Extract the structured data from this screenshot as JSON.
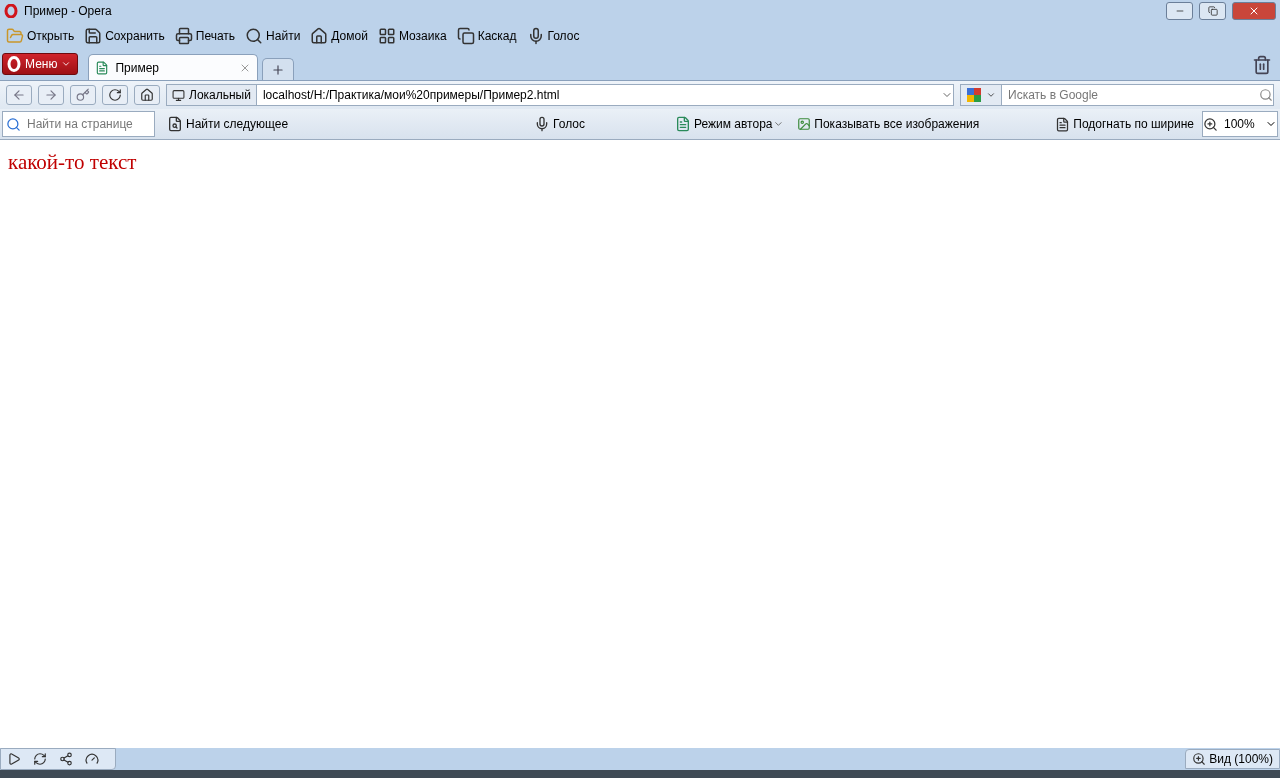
{
  "window": {
    "title": "Пример - Opera"
  },
  "toolbar": {
    "buttons": [
      "Открыть",
      "Сохранить",
      "Печать",
      "Найти",
      "Домой",
      "Мозаика",
      "Каскад",
      "Голос"
    ]
  },
  "menu_button": {
    "label": "Меню"
  },
  "tabs": [
    {
      "label": "Пример",
      "selected": true
    }
  ],
  "address_bar": {
    "badge": "Локальный",
    "url": "localhost/H:/Практика/мои%20примеры/Пример2.html"
  },
  "search": {
    "placeholder": "Искать в Google"
  },
  "find_bar": {
    "find_placeholder": "Найти на странице",
    "find_next": "Найти следующее",
    "voice": "Голос",
    "author_mode": "Режим автора",
    "show_images": "Показывать все изображения",
    "fit_width": "Подогнать по ширине",
    "zoom": "100%"
  },
  "page": {
    "text": "какой-то текст"
  },
  "status_bar": {
    "view": "Вид (100%)"
  }
}
